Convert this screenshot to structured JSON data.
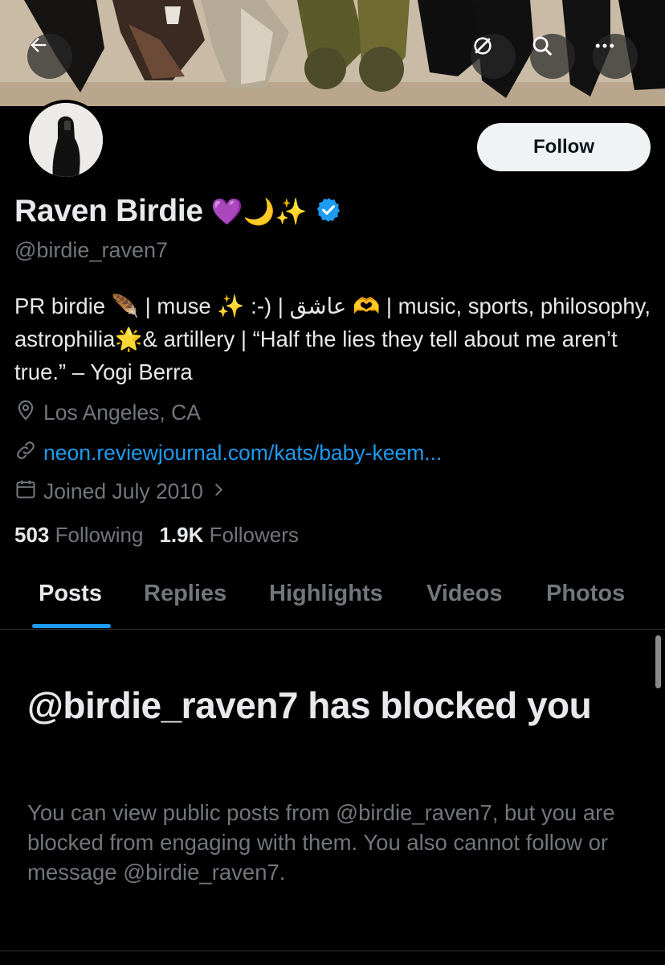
{
  "header": {
    "back_icon": "back-arrow-icon",
    "grok_icon": "grok-slash-icon",
    "search_icon": "search-icon",
    "more_icon": "more-dots-icon"
  },
  "profile": {
    "follow_label": "Follow",
    "name": "Raven Birdie",
    "name_emojis": "💜🌙✨",
    "verified_color": "#1d9bf0",
    "handle": "@birdie_raven7",
    "bio": "PR birdie 🪶 | muse ✨ :-) | عاشق 🫶 | music, sports, philosophy, astrophilia🌟& artillery | “Half the lies they tell about me aren’t true.” – Yogi Berra",
    "location": "Los Angeles, CA",
    "link": "neon.reviewjournal.com/kats/baby-keem...",
    "joined": "Joined July 2010",
    "following_count": "503",
    "following_label": "Following",
    "followers_count": "1.9K",
    "followers_label": "Followers"
  },
  "tabs": [
    "Posts",
    "Replies",
    "Highlights",
    "Videos",
    "Photos"
  ],
  "blocked": {
    "title": "@birdie_raven7 has blocked you",
    "description": "You can view public posts from @birdie_raven7, but you are blocked from engaging with them. You also cannot follow or message @birdie_raven7."
  },
  "colors": {
    "accent": "#1d9bf0",
    "text": "#e7e9ea",
    "muted": "#71767b"
  }
}
